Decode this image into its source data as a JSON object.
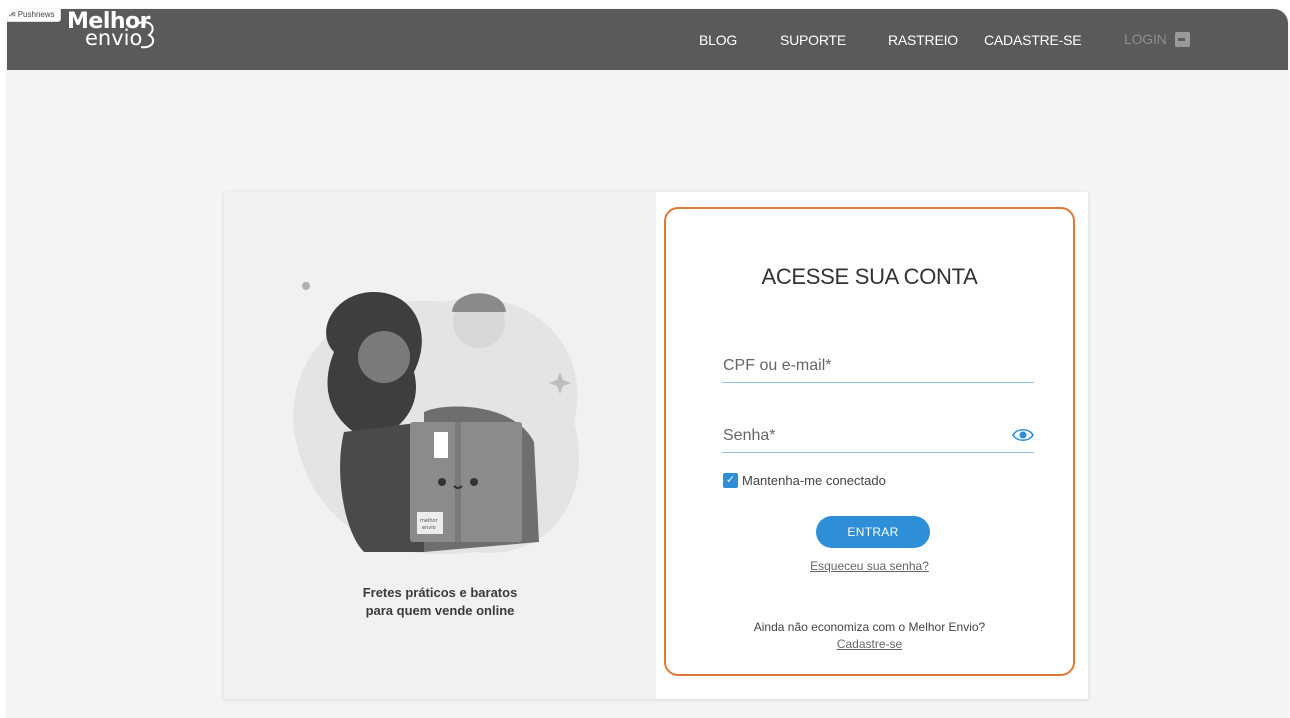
{
  "browser": {
    "push_badge": "Pushnews"
  },
  "header": {
    "logo_line1": "Melhor",
    "logo_line2": "envio",
    "nav": {
      "blog": "BLOG",
      "suporte": "SUPORTE",
      "rastreio": "RASTREIO",
      "cadastre": "CADASTRE-SE",
      "login": "LOGIN"
    }
  },
  "illustration": {
    "tagline_line1": "Fretes práticos e baratos",
    "tagline_line2": "para quem vende online",
    "box_label_line1": "melhor",
    "box_label_line2": "envio"
  },
  "login_form": {
    "title": "ACESSE SUA CONTA",
    "email_placeholder": "CPF ou e-mail*",
    "password_placeholder": "Senha*",
    "remember_label": "Mantenha-me conectado",
    "remember_checked": true,
    "submit_label": "ENTRAR",
    "forgot_link": "Esqueceu sua senha?",
    "promo_text": "Ainda não economiza com o Melhor Envio?",
    "signup_link": "Cadastre-se"
  },
  "colors": {
    "topbar": "#5a5a5a",
    "accent_blue": "#2f8ed8",
    "highlight_orange": "#e07a36"
  }
}
